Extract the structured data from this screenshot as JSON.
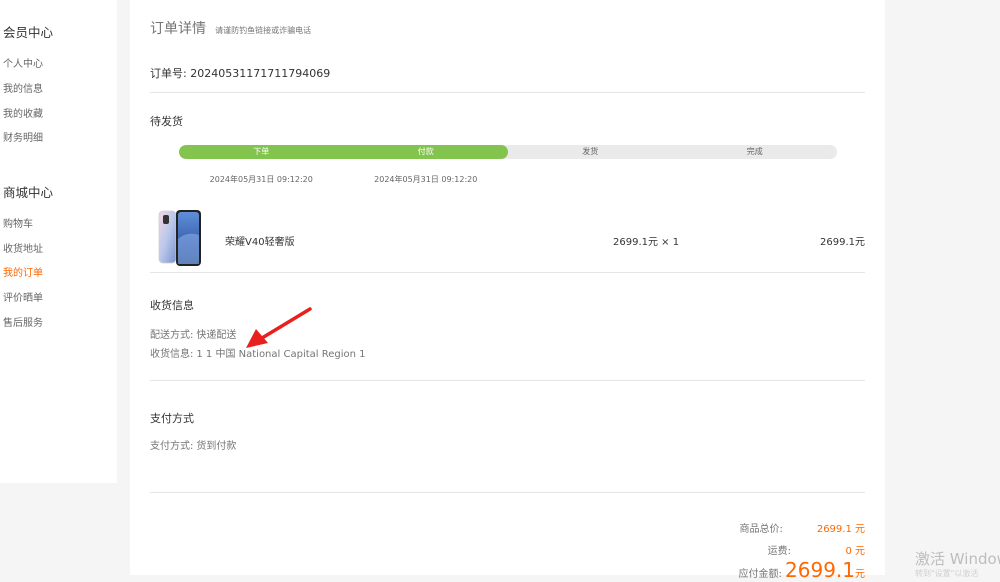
{
  "sidebar": {
    "member_title": "会员中心",
    "member_items": [
      {
        "label": "个人中心"
      },
      {
        "label": "我的信息"
      },
      {
        "label": "我的收藏"
      },
      {
        "label": "财务明细"
      }
    ],
    "mall_title": "商城中心",
    "mall_items": [
      {
        "label": "购物车"
      },
      {
        "label": "收货地址"
      },
      {
        "label": "我的订单",
        "active": true
      },
      {
        "label": "评价晒单"
      },
      {
        "label": "售后服务"
      }
    ]
  },
  "order": {
    "title": "订单详情",
    "subtitle": "请谨防钓鱼链接或诈骗电话",
    "number_label": "订单号:",
    "number": "20240531171711794069",
    "status": "待发货",
    "progress_completed_steps": 2,
    "steps": [
      {
        "label": "下单",
        "time": "2024年05月31日 09:12:20"
      },
      {
        "label": "付款",
        "time": "2024年05月31日 09:12:20"
      },
      {
        "label": "发货",
        "time": ""
      },
      {
        "label": "完成",
        "time": ""
      }
    ]
  },
  "product": {
    "name": "荣耀V40轻奢版",
    "unit_price": "2699.1元 × 1",
    "total": "2699.1元"
  },
  "shipping": {
    "title": "收货信息",
    "method_label": "配送方式:",
    "method": "快递配送",
    "address_label": "收货信息:",
    "address": "1 1 中国 National Capital Region 1"
  },
  "payment": {
    "title": "支付方式",
    "method_label": "支付方式:",
    "method": "货到付款"
  },
  "summary": {
    "goods_total_label": "商品总价:",
    "goods_total": "2699.1 元",
    "shipping_label": "运费:",
    "shipping": "0 元",
    "payable_label": "应付金额:",
    "payable_amount": "2699.1",
    "payable_unit": "元"
  },
  "watermark": {
    "title": "激活 Windows",
    "subtitle": "转到\"设置\"以激活"
  },
  "colors": {
    "accent": "#ff6700",
    "progress_done": "#83c44e",
    "progress_todo": "#eaeaea",
    "annotation_arrow": "#e8211f"
  }
}
